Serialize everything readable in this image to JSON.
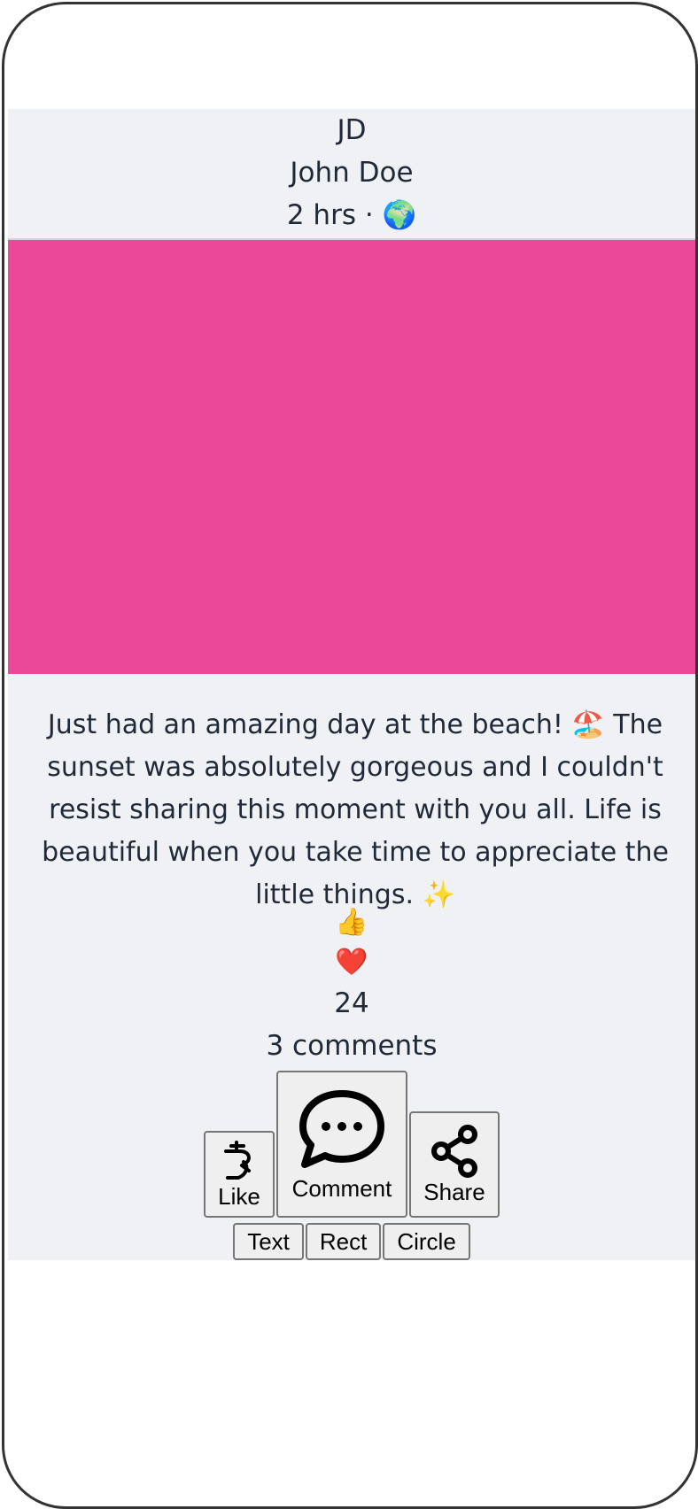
{
  "author": {
    "initials": "JD",
    "name": "John Doe",
    "time": "2 hrs",
    "separator": "·",
    "visibility_icon": "🌍"
  },
  "post": {
    "image_color": "#ec4899",
    "text": "Just had an amazing day at the beach! 🏖️ The sunset was absolutely gorgeous and I couldn't resist sharing this moment with you all. Life is beautiful when you take time to appreciate the little things. ✨"
  },
  "reactions": {
    "like_emoji": "👍",
    "love_emoji": "❤️",
    "count": "24",
    "comments": "3 comments"
  },
  "actions": {
    "like_label": "Like",
    "like_icon": "hand-pointer-icon",
    "comment_label": "Comment",
    "comment_icon": "speech-bubble-icon",
    "share_label": "Share",
    "share_icon": "share-nodes-icon"
  },
  "shape_buttons": {
    "text_label": "Text",
    "rect_label": "Rect",
    "circle_label": "Circle"
  }
}
